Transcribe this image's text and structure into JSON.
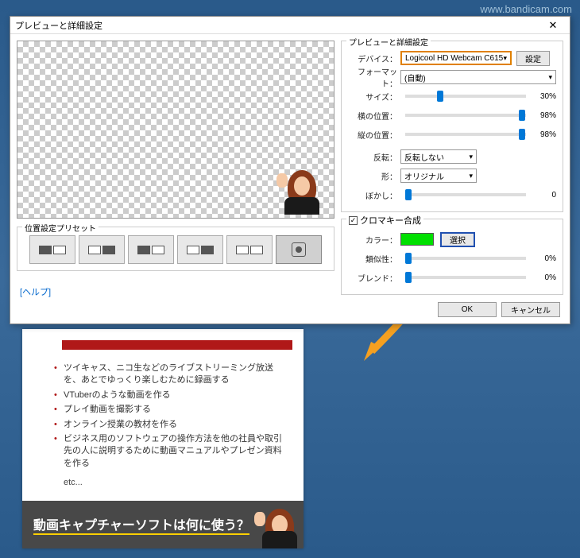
{
  "watermark": "www.bandicam.com",
  "dialog": {
    "title": "プレビューと詳細設定",
    "close": "✕",
    "preset_group_label": "位置設定プリセット",
    "help_link": "[ヘルプ]",
    "settings_group_label": "プレビューと詳細設定",
    "rows": {
      "device_label": "デバイス：",
      "device_value": "Logicool HD Webcam C615",
      "device_btn": "設定",
      "format_label": "フォーマット：",
      "format_value": "(自動)",
      "size_label": "サイズ：",
      "size_value": "30%",
      "hpos_label": "横の位置：",
      "hpos_value": "98%",
      "vpos_label": "縦の位置：",
      "vpos_value": "98%",
      "flip_label": "反転：",
      "flip_value": "反転しない",
      "shape_label": "形：",
      "shape_value": "オリジナル",
      "blur_label": "ぼかし：",
      "blur_value": "0"
    },
    "chroma": {
      "checkbox_label": "クロマキー合成",
      "color_label": "カラー：",
      "color_btn": "選択",
      "similarity_label": "類似性：",
      "similarity_value": "0%",
      "blend_label": "ブレンド：",
      "blend_value": "0%"
    },
    "ok": "OK",
    "cancel": "キャンセル"
  },
  "bgdoc": {
    "items": [
      "ツイキャス、ニコ生などのライブストリーミング放送を、あとでゆっくり楽しむために録画する",
      "VTuberのような動画を作る",
      "プレイ動画を撮影する",
      "オンライン授業の教材を作る",
      "ビジネス用のソフトウェアの操作方法を他の社員や取引先の人に説明するために動画マニュアルやプレゼン資料を作る"
    ],
    "etc": "etc...",
    "question": "動画キャプチャーソフトは何に使う？"
  }
}
